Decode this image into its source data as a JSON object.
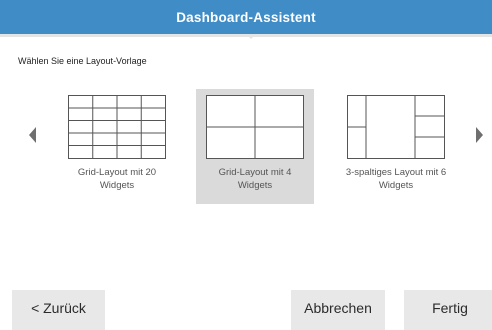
{
  "dialog": {
    "title": "Dashboard-Assistent",
    "instruction": "Wählen Sie eine Layout-Vorlage"
  },
  "templates": [
    {
      "line1": "Grid-Layout mit 20",
      "line2": "Widgets",
      "selected": false
    },
    {
      "line1": "Grid-Layout mit 4",
      "line2": "Widgets",
      "selected": true
    },
    {
      "line1": "3-spaltiges Layout mit 6",
      "line2": "Widgets",
      "selected": false
    }
  ],
  "buttons": {
    "back": "< Zurück",
    "cancel": "Abbrechen",
    "finish": "Fertig"
  },
  "colors": {
    "titlebar": "#3f8cc6",
    "selected_bg": "#dadada",
    "button_bg": "#e8e8e8"
  }
}
